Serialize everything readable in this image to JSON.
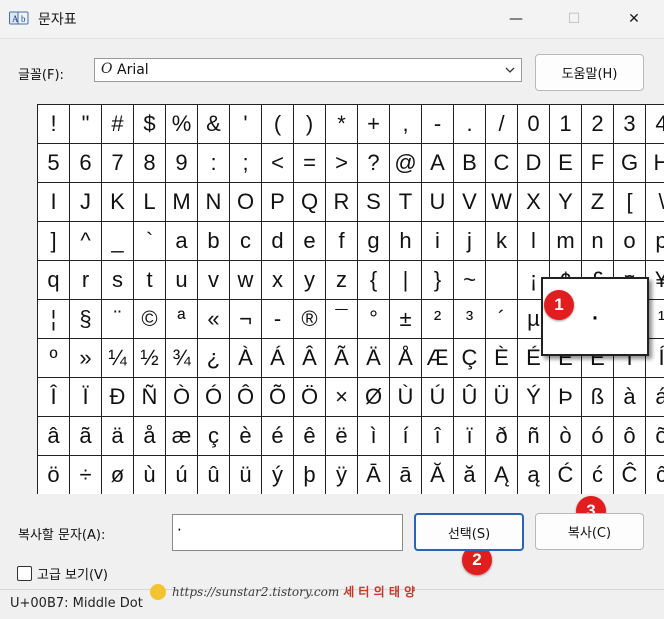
{
  "window": {
    "title": "문자표",
    "minimize": "—",
    "maximize": "☐",
    "close": "✕"
  },
  "font": {
    "label": "글꼴(F):",
    "icon_glyph": "O",
    "value": "Arial"
  },
  "buttons": {
    "help": "도움말(H)",
    "select": "선택(S)",
    "copy": "복사(C)"
  },
  "characters": [
    "!",
    "\"",
    "#",
    "$",
    "%",
    "&",
    "'",
    "(",
    ")",
    "*",
    "+",
    ",",
    "-",
    ".",
    "/",
    "0",
    "1",
    "2",
    "3",
    "4",
    "5",
    "6",
    "7",
    "8",
    "9",
    ":",
    ";",
    "<",
    "=",
    ">",
    "?",
    "@",
    "A",
    "B",
    "C",
    "D",
    "E",
    "F",
    "G",
    "H",
    "I",
    "J",
    "K",
    "L",
    "M",
    "N",
    "O",
    "P",
    "Q",
    "R",
    "S",
    "T",
    "U",
    "V",
    "W",
    "X",
    "Y",
    "Z",
    "[",
    "\\",
    "]",
    "^",
    "_",
    "`",
    "a",
    "b",
    "c",
    "d",
    "e",
    "f",
    "g",
    "h",
    "i",
    "j",
    "k",
    "l",
    "m",
    "n",
    "o",
    "p",
    "q",
    "r",
    "s",
    "t",
    "u",
    "v",
    "w",
    "x",
    "y",
    "z",
    "{",
    "|",
    "}",
    "~",
    " ",
    "¡",
    "¢",
    "£",
    "¤",
    "¥",
    "¦",
    "§",
    "¨",
    "©",
    "ª",
    "«",
    "¬",
    "-",
    "®",
    "¯",
    "°",
    "±",
    "²",
    "³",
    "´",
    "µ",
    "¶",
    "·",
    "¸",
    "¹",
    "º",
    "»",
    "¼",
    "½",
    "¾",
    "¿",
    "À",
    "Á",
    "Â",
    "Ã",
    "Ä",
    "Å",
    "Æ",
    "Ç",
    "È",
    "É",
    "Ê",
    "Ë",
    "Ì",
    "Í",
    "Î",
    "Ï",
    "Ð",
    "Ñ",
    "Ò",
    "Ó",
    "Ô",
    "Õ",
    "Ö",
    "×",
    "Ø",
    "Ù",
    "Ú",
    "Û",
    "Ü",
    "Ý",
    "Þ",
    "ß",
    "à",
    "á",
    "â",
    "ã",
    "ä",
    "å",
    "æ",
    "ç",
    "è",
    "é",
    "ê",
    "ë",
    "ì",
    "í",
    "î",
    "ï",
    "ð",
    "ñ",
    "ò",
    "ó",
    "ô",
    "õ",
    "ö",
    "÷",
    "ø",
    "ù",
    "ú",
    "û",
    "ü",
    "ý",
    "þ",
    "ÿ",
    "Ā",
    "ā",
    "Ă",
    "ă",
    "Ą",
    "ą",
    "Ć",
    "ć",
    "Ĉ",
    "ĉ"
  ],
  "magnified": {
    "char": "·"
  },
  "badges": {
    "one": "1",
    "two": "2",
    "three": "3"
  },
  "copy": {
    "label": "복사할 문자(A):",
    "value": "·"
  },
  "advanced": {
    "label": "고급 보기(V)",
    "checked": false
  },
  "status": {
    "text": "U+00B7: Middle Dot"
  },
  "watermark": {
    "url": "https://sunstar2.tistory.com",
    "brand": "세 터 의 태 양"
  }
}
